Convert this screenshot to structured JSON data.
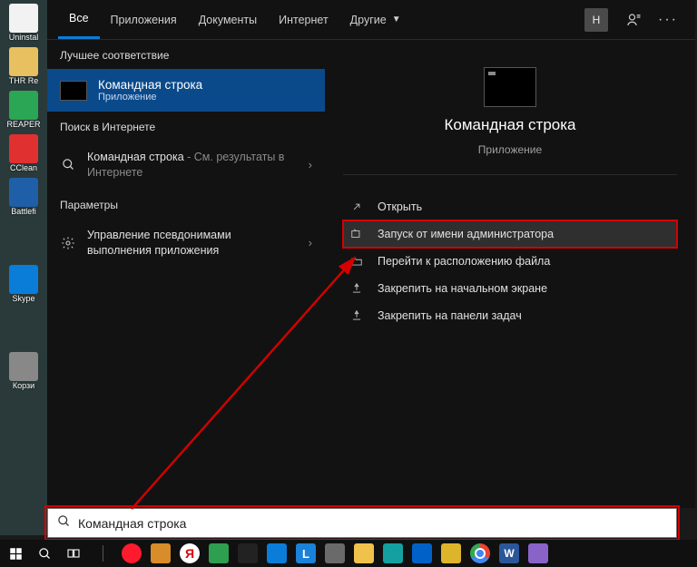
{
  "tabs": {
    "items": [
      "Все",
      "Приложения",
      "Документы",
      "Интернет",
      "Другие"
    ],
    "active_index": 0,
    "avatar_letter": "Н"
  },
  "left": {
    "best_match_label": "Лучшее соответствие",
    "best_match": {
      "title": "Командная строка",
      "subtitle": "Приложение"
    },
    "web_label": "Поиск в Интернете",
    "web_item": {
      "prefix": "Командная строка",
      "suffix": " - См. результаты в Интернете"
    },
    "settings_label": "Параметры",
    "settings_item": "Управление псевдонимами выполнения приложения"
  },
  "preview": {
    "title": "Командная строка",
    "subtitle": "Приложение",
    "actions": [
      {
        "label": "Открыть"
      },
      {
        "label": "Запуск от имени администратора",
        "highlight": true
      },
      {
        "label": "Перейти к расположению файла"
      },
      {
        "label": "Закрепить на начальном экране"
      },
      {
        "label": "Закрепить на панели задач"
      }
    ]
  },
  "search": {
    "value": "Командная строка"
  },
  "desktop_icons": [
    {
      "label": "Uninstal",
      "color": "#f2f2f2"
    },
    {
      "label": "THR Re",
      "color": "#e8c060"
    },
    {
      "label": "REAPER",
      "color": "#2aa655"
    },
    {
      "label": "CClean",
      "color": "#e03030"
    },
    {
      "label": "Battlefi",
      "color": "#1f5fa8"
    },
    {
      "label": "",
      "color": ""
    },
    {
      "label": "Skype",
      "color": "#0a7dd9"
    },
    {
      "label": "",
      "color": ""
    },
    {
      "label": "Корзи",
      "color": "#888"
    }
  ],
  "taskbar": [
    {
      "name": "start",
      "color": ""
    },
    {
      "name": "search",
      "color": ""
    },
    {
      "name": "taskview",
      "color": ""
    },
    {
      "name": "divider",
      "color": ""
    },
    {
      "name": "opera",
      "color": "#ff1b2d"
    },
    {
      "name": "files",
      "color": "#d88c2a"
    },
    {
      "name": "yandex",
      "color": "#ffffff"
    },
    {
      "name": "app-green",
      "color": "#2e9e4f"
    },
    {
      "name": "app-star",
      "color": "#222"
    },
    {
      "name": "mail",
      "color": "#0a7dd9"
    },
    {
      "name": "app-L",
      "color": "#1a82d8"
    },
    {
      "name": "app-grey",
      "color": "#6a6a6a"
    },
    {
      "name": "explorer",
      "color": "#f0c24b"
    },
    {
      "name": "app-teal",
      "color": "#14a0a0"
    },
    {
      "name": "app-blue",
      "color": "#0062c8"
    },
    {
      "name": "app-yellow",
      "color": "#ddb52a"
    },
    {
      "name": "chrome",
      "color": ""
    },
    {
      "name": "word",
      "color": "#2b579a"
    },
    {
      "name": "paint",
      "color": "#8a63c8"
    }
  ]
}
